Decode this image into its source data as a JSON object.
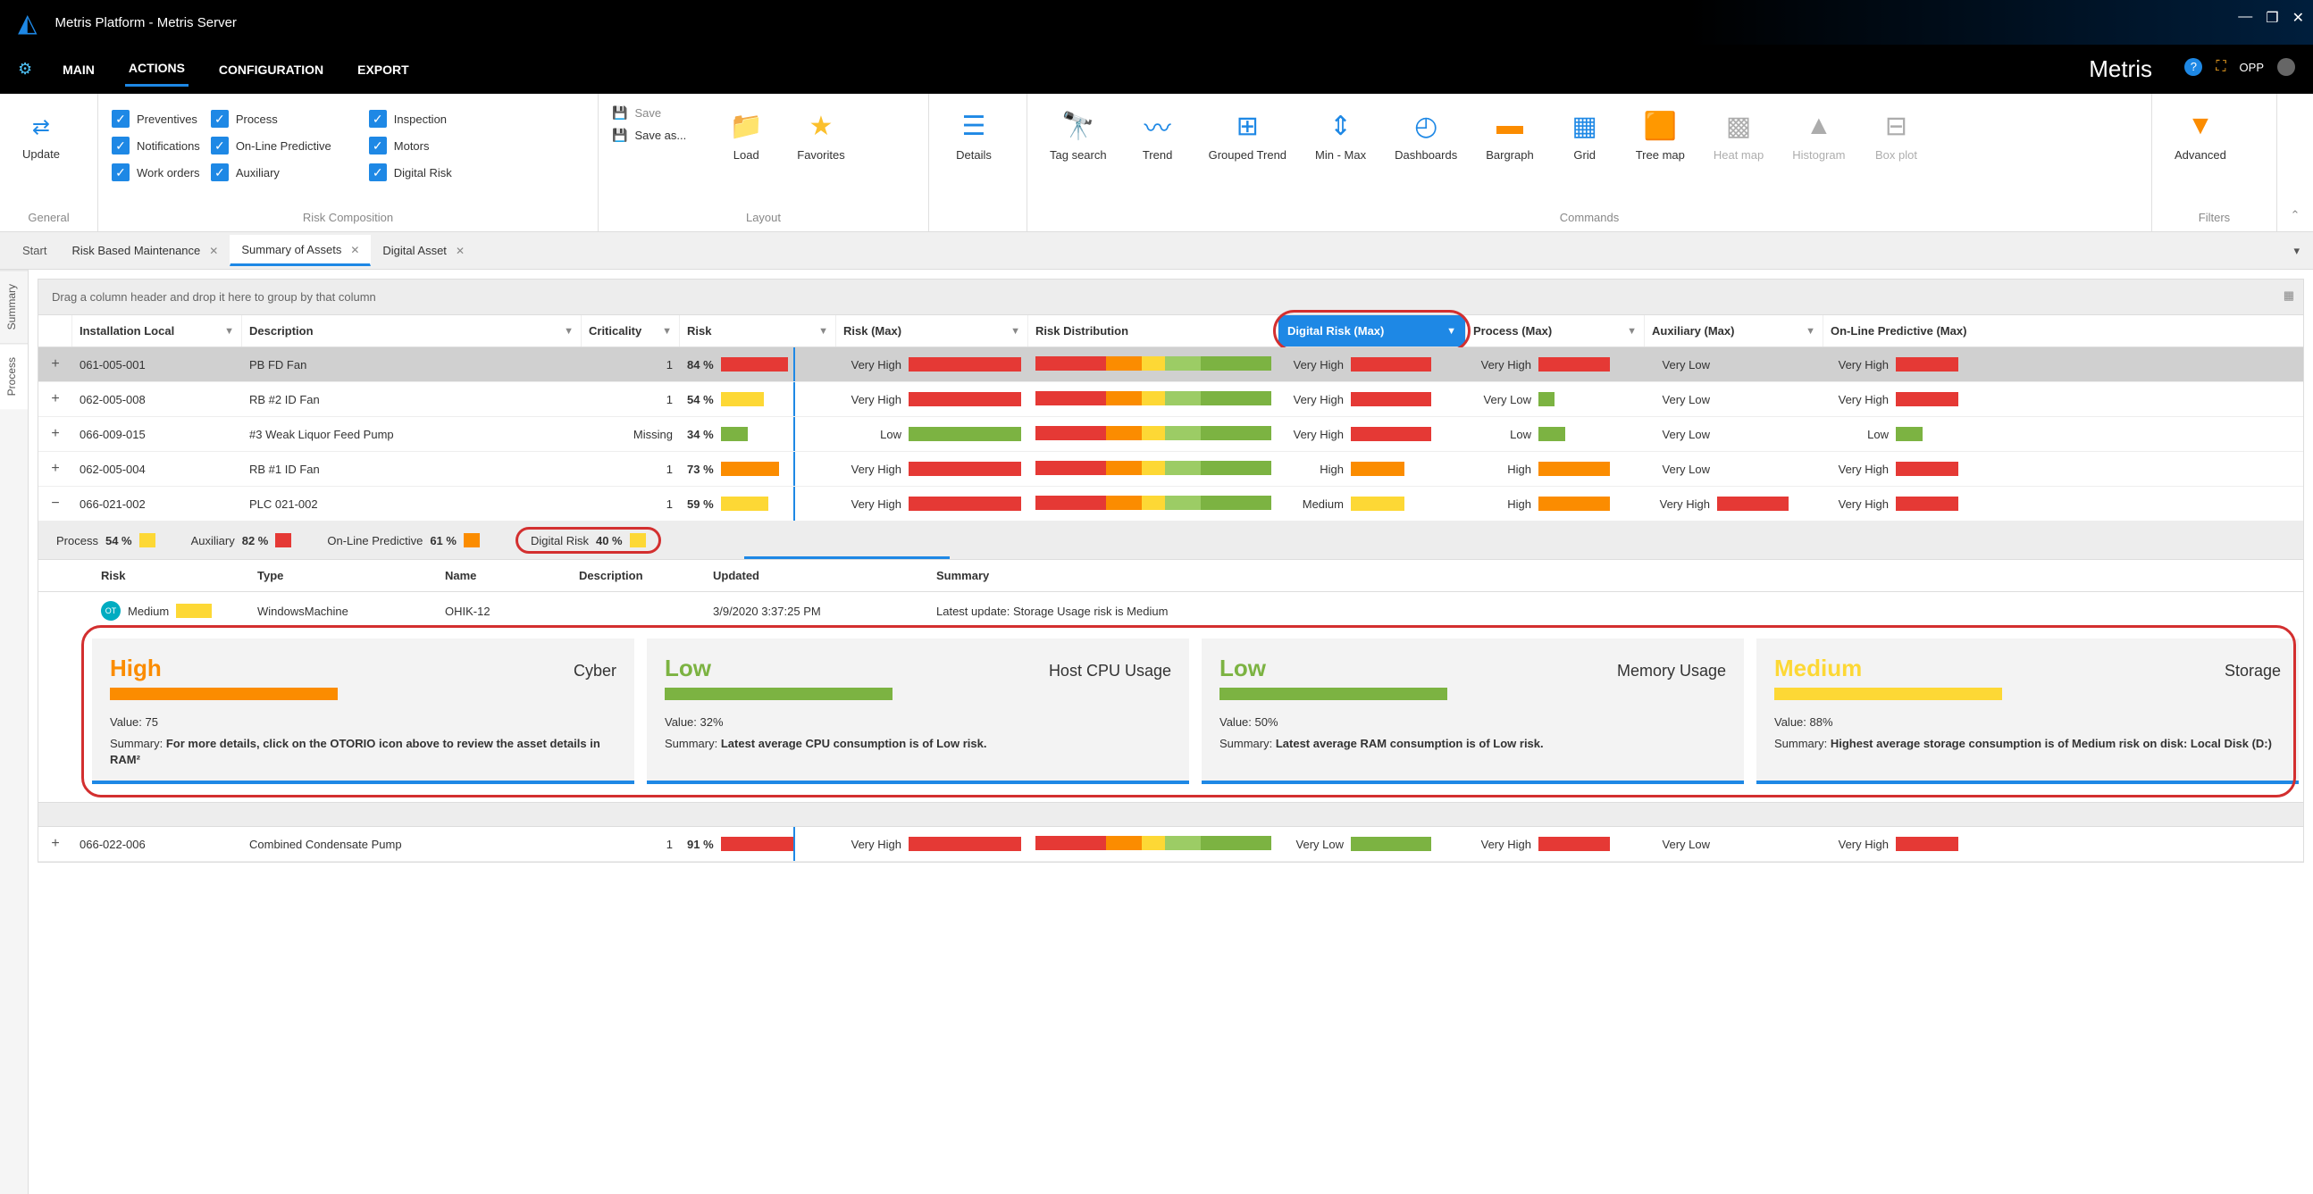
{
  "window": {
    "title": "Metris Platform - Metris Server",
    "brand": "Metris",
    "user_label": "OPP"
  },
  "menu": {
    "items": [
      "MAIN",
      "ACTIONS",
      "CONFIGURATION",
      "EXPORT"
    ],
    "active": "ACTIONS"
  },
  "ribbon": {
    "update": "Update",
    "general_label": "General",
    "risk_comp_label": "Risk Composition",
    "layout_label": "Layout",
    "commands_label": "Commands",
    "filters_label": "Filters",
    "checks": {
      "col1": [
        "Preventives",
        "Notifications",
        "Work orders"
      ],
      "col2": [
        "Process",
        "On-Line Predictive",
        "Auxiliary"
      ],
      "col3": [
        "Inspection",
        "Motors",
        "Digital Risk"
      ]
    },
    "save": "Save",
    "save_as": "Save as...",
    "load": "Load",
    "favorites": "Favorites",
    "details": "Details",
    "tag_search": "Tag search",
    "trend": "Trend",
    "grouped_trend": "Grouped Trend",
    "min_max": "Min - Max",
    "dashboards": "Dashboards",
    "bargraph": "Bargraph",
    "grid": "Grid",
    "tree_map": "Tree map",
    "heat_map": "Heat map",
    "histogram": "Histogram",
    "box_plot": "Box plot",
    "advanced": "Advanced"
  },
  "tabs": {
    "start": "Start",
    "items": [
      "Risk Based Maintenance",
      "Summary of Assets",
      "Digital Asset"
    ],
    "active": "Summary of Assets"
  },
  "side_tabs": [
    "Summary",
    "Process"
  ],
  "group_hint": "Drag a column header and drop it here to group by that column",
  "columns": {
    "install": "Installation Local",
    "desc": "Description",
    "crit": "Criticality",
    "risk": "Risk",
    "riskmax": "Risk (Max)",
    "dist": "Risk Distribution",
    "digital": "Digital Risk (Max)",
    "process": "Process (Max)",
    "aux": "Auxiliary (Max)",
    "online": "On-Line Predictive (Max)"
  },
  "rows": [
    {
      "install": "061-005-001",
      "desc": "PB FD Fan",
      "crit": "1",
      "risk": "84 %",
      "riskmax": "Very High",
      "digital": "Very High",
      "process": "Very High",
      "aux": "Very Low",
      "online": "Very High",
      "selected": true,
      "expand": "+"
    },
    {
      "install": "062-005-008",
      "desc": "RB #2 ID Fan",
      "crit": "1",
      "risk": "54 %",
      "riskmax": "Very High",
      "digital": "Very High",
      "process": "Very Low",
      "aux": "Very Low",
      "online": "Very High",
      "expand": "+"
    },
    {
      "install": "066-009-015",
      "desc": "#3 Weak Liquor Feed Pump",
      "crit": "Missing",
      "risk": "34 %",
      "riskmax": "Low",
      "digital": "Very High",
      "process": "Low",
      "aux": "Very Low",
      "online": "Low",
      "expand": "+"
    },
    {
      "install": "062-005-004",
      "desc": "RB #1 ID Fan",
      "crit": "1",
      "risk": "73 %",
      "riskmax": "Very High",
      "digital": "High",
      "process": "High",
      "aux": "Very Low",
      "online": "Very High",
      "expand": "+"
    },
    {
      "install": "066-021-002",
      "desc": "PLC 021-002",
      "crit": "1",
      "risk": "59 %",
      "riskmax": "Very High",
      "digital": "Medium",
      "process": "High",
      "aux": "Very High",
      "online": "Very High",
      "expand": "−"
    }
  ],
  "summary": {
    "process": {
      "label": "Process",
      "value": "54 %"
    },
    "auxiliary": {
      "label": "Auxiliary",
      "value": "82 %"
    },
    "online": {
      "label": "On-Line Predictive",
      "value": "61 %"
    },
    "digital": {
      "label": "Digital Risk",
      "value": "40 %"
    }
  },
  "detail_cols": {
    "risk": "Risk",
    "type": "Type",
    "name": "Name",
    "desc": "Description",
    "updated": "Updated",
    "summary": "Summary"
  },
  "detail_row": {
    "risk": "Medium",
    "type": "WindowsMachine",
    "name": "OHIK-12",
    "desc": "",
    "updated": "3/9/2020 3:37:25 PM",
    "summary": "Latest update: Storage Usage risk is Medium"
  },
  "cards": [
    {
      "level": "High",
      "level_class": "high",
      "title": "Cyber",
      "bar": "orange",
      "value": "Value:  75",
      "summary_pre": "Summary: ",
      "summary_bold": "For more details, click on the OTORIO icon above to review the asset details in RAM²"
    },
    {
      "level": "Low",
      "level_class": "low",
      "title": "Host CPU Usage",
      "bar": "green",
      "value": "Value:  32%",
      "summary_pre": "Summary: ",
      "summary_bold": "Latest average CPU consumption is of Low risk."
    },
    {
      "level": "Low",
      "level_class": "low",
      "title": "Memory Usage",
      "bar": "green",
      "value": "Value:  50%",
      "summary_pre": "Summary: ",
      "summary_bold": "Latest average RAM consumption is of Low risk."
    },
    {
      "level": "Medium",
      "level_class": "medium",
      "title": "Storage",
      "bar": "yellow",
      "value": "Value:  88%",
      "summary_pre": "Summary: ",
      "summary_bold": "Highest average storage consumption is of Medium risk on disk: Local Disk (D:)"
    }
  ],
  "bottom_row": {
    "install": "066-022-006",
    "desc": "Combined Condensate Pump",
    "crit": "1",
    "risk": "91 %",
    "riskmax": "Very High",
    "digital": "Very Low",
    "process": "Very High",
    "aux": "Very Low",
    "online": "Very High",
    "expand": "+"
  }
}
